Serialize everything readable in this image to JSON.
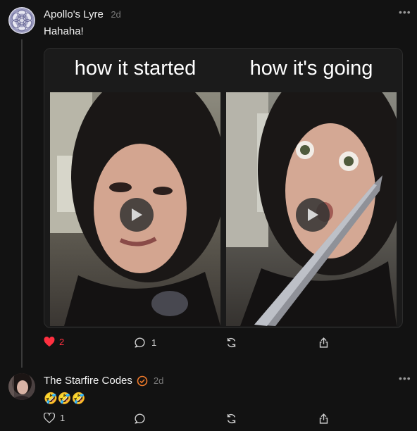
{
  "post": {
    "author": "Apollo's Lyre",
    "time": "2d",
    "text": "Hahaha!",
    "media": {
      "left_caption": "how it started",
      "right_caption": "how it's going"
    },
    "actions": {
      "likes": "2",
      "replies": "1"
    }
  },
  "reply": {
    "author": "The Starfire Codes",
    "time": "2d",
    "text": "🤣🤣🤣",
    "actions": {
      "likes": "1"
    }
  },
  "icons": {
    "more": "ellipsis-icon",
    "like_active": "heart-filled-icon",
    "like": "heart-icon",
    "reply": "comment-icon",
    "repost": "repost-icon",
    "share": "share-icon",
    "verified": "verified-check-icon",
    "play": "play-icon"
  },
  "colors": {
    "background": "#121212",
    "like_red": "#ff3040",
    "verified_orange": "#f07a2a"
  }
}
